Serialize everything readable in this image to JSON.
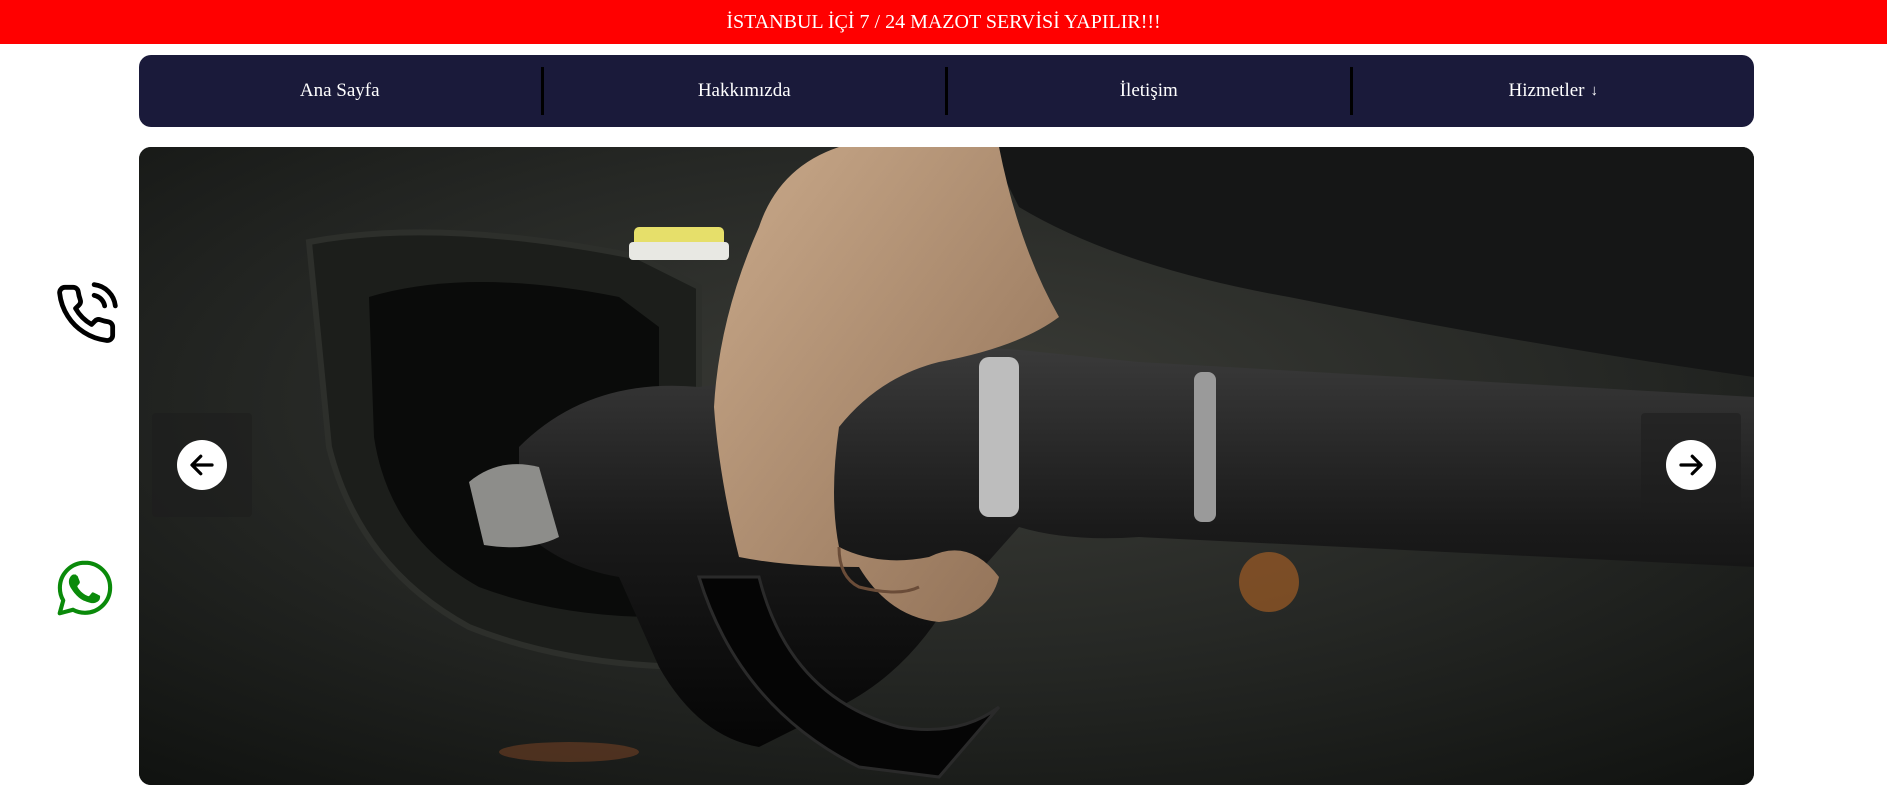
{
  "banner": {
    "text": "İSTANBUL İÇİ 7 / 24 MAZOT SERVİSİ YAPILIR!!!"
  },
  "nav": {
    "items": [
      {
        "label": "Ana Sayfa"
      },
      {
        "label": "Hakkımızda"
      },
      {
        "label": "İletişim"
      },
      {
        "label": "Hizmetler",
        "arrow": "↓"
      }
    ]
  },
  "slider": {
    "prev_icon": "arrow-left-icon",
    "next_icon": "arrow-right-icon",
    "image": "fuel-nozzle-photo"
  },
  "floating": {
    "phone_icon": "phone-call-icon",
    "whatsapp_icon": "whatsapp-icon",
    "whatsapp_color": "#0a8a0a"
  },
  "colors": {
    "banner": "#ff0000",
    "nav_bg": "#1a1a3a",
    "nav_text": "#ffffff"
  }
}
